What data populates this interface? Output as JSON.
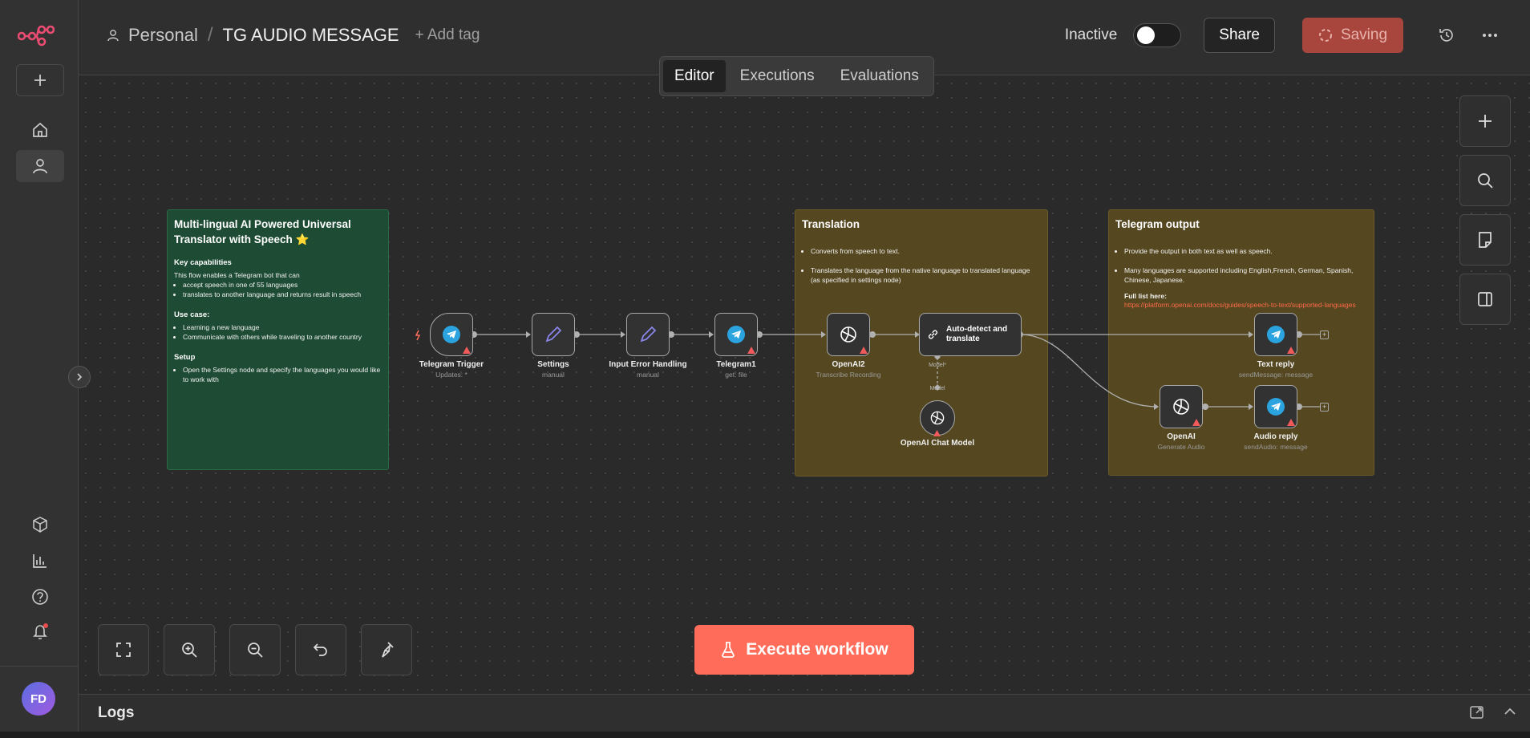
{
  "header": {
    "project": "Personal",
    "separator": "/",
    "workflow_title": "TG AUDIO MESSAGE",
    "add_tag": "+ Add tag",
    "status_label": "Inactive",
    "share_label": "Share",
    "saving_label": "Saving"
  },
  "tabs": [
    {
      "label": "Editor",
      "active": true
    },
    {
      "label": "Executions",
      "active": false
    },
    {
      "label": "Evaluations",
      "active": false
    }
  ],
  "rail": {
    "avatar_initials": "FD",
    "accent": "#ff6d5a"
  },
  "stickies": {
    "main": {
      "title": "Multi-lingual AI Powered Universal Translator with Speech ⭐",
      "cap_heading": "Key capabilities",
      "cap_intro": "This flow enables a Telegram bot that can",
      "caps": [
        "accept speech in one of 55 languages",
        "translates to another language and returns result in speech"
      ],
      "use_heading": "Use case:",
      "uses": [
        "Learning a new language",
        "Communicate with others while traveling to another country"
      ],
      "setup_heading": "Setup",
      "setup": [
        "Open the Settings node and specify the languages you would like to work with"
      ]
    },
    "translation": {
      "title": "Translation",
      "items": [
        "Converts from speech to text.",
        "Translates the language from the native language to translated language (as specified in settings node)"
      ]
    },
    "output": {
      "title": "Telegram output",
      "items": [
        "Provide the output in both text as well as speech.",
        "Many languages are supported including English,French, German, Spanish, Chinese, Japanese."
      ],
      "full_list": "Full list here:",
      "link": "https://platform.openai.com/docs/guides/speech-to-text/supported-languages"
    }
  },
  "nodes": {
    "telegram_trigger": {
      "name": "Telegram Trigger",
      "sub": "Updates: *"
    },
    "settings": {
      "name": "Settings",
      "sub": "manual"
    },
    "input_error": {
      "name": "Input Error Handling",
      "sub": "manual"
    },
    "telegram1": {
      "name": "Telegram1",
      "sub": "get: file"
    },
    "openai2": {
      "name": "OpenAI2",
      "sub": "Transcribe Recording"
    },
    "autodetect": {
      "name": "Auto-detect and translate",
      "port_label": "Model*"
    },
    "chat_model": {
      "name": "OpenAI Chat Model",
      "port_label": "Model"
    },
    "text_reply": {
      "name": "Text reply",
      "sub": "sendMessage: message"
    },
    "openai": {
      "name": "OpenAI",
      "sub": "Generate Audio"
    },
    "audio_reply": {
      "name": "Audio reply",
      "sub": "sendAudio: message"
    }
  },
  "execute_label": "Execute workflow",
  "logs_label": "Logs"
}
